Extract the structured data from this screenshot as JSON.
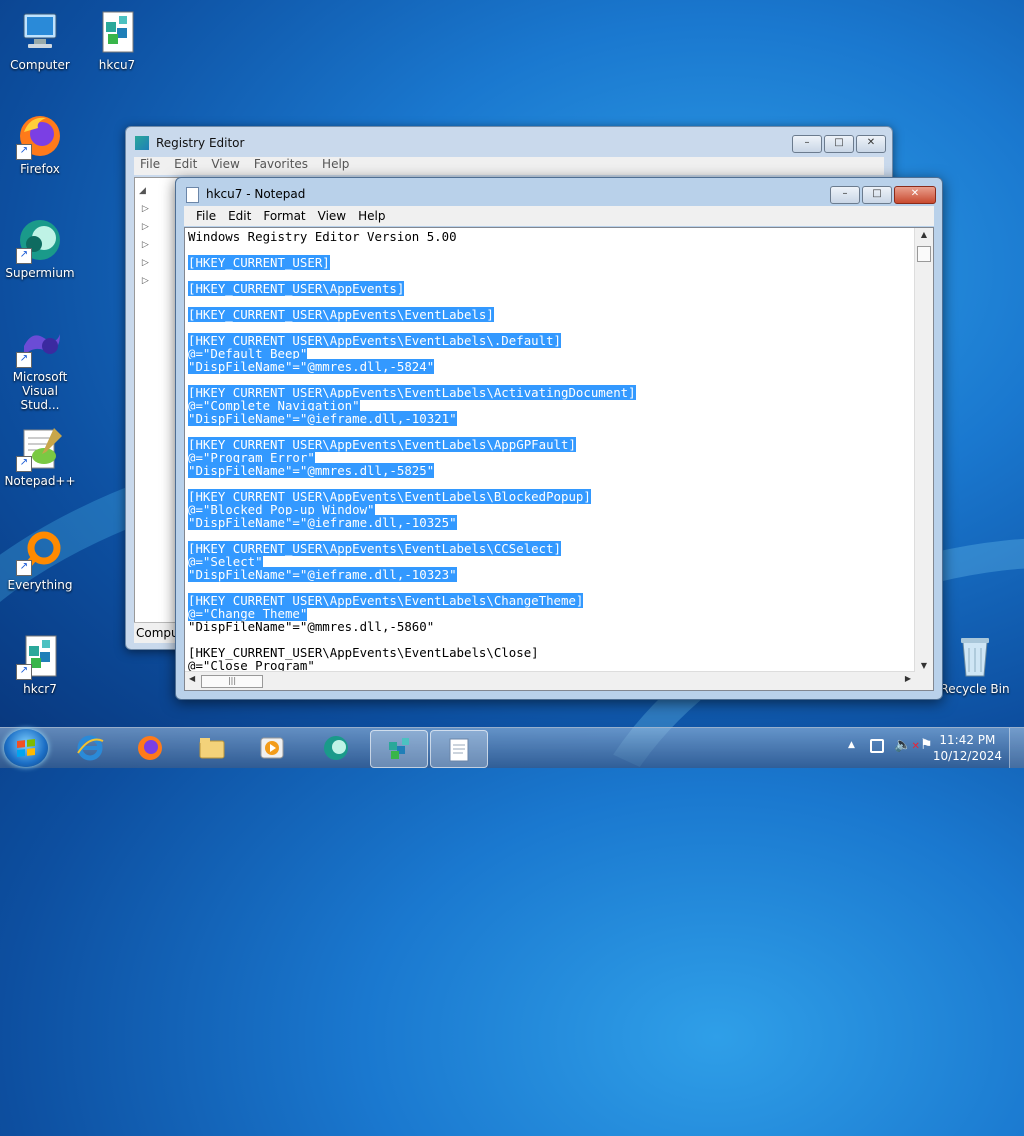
{
  "desktop": {
    "icons": [
      {
        "label": "Computer",
        "icon": "computer-icon"
      },
      {
        "label": "hkcu7",
        "icon": "registry-file-icon"
      },
      {
        "label": "Firefox",
        "icon": "firefox-icon"
      },
      {
        "label": "Supermium",
        "icon": "supermium-icon"
      },
      {
        "label": "Microsoft Visual Stud...",
        "icon": "visual-studio-icon"
      },
      {
        "label": "Notepad++",
        "icon": "notepadpp-icon"
      },
      {
        "label": "Everything",
        "icon": "everything-icon"
      },
      {
        "label": "hkcr7",
        "icon": "registry-file-icon"
      },
      {
        "label": "Recycle Bin",
        "icon": "recycle-bin-icon"
      }
    ]
  },
  "registry_editor": {
    "title": "Registry Editor",
    "menu": [
      "File",
      "Edit",
      "View",
      "Favorites",
      "Help"
    ],
    "status": "Compu"
  },
  "notepad": {
    "title": "hkcu7 - Notepad",
    "menu": [
      "File",
      "Edit",
      "Format",
      "View",
      "Help"
    ],
    "lines": [
      {
        "text": "Windows Registry Editor Version 5.00",
        "selected": false
      },
      {
        "text": "",
        "selected": false
      },
      {
        "text": "[HKEY_CURRENT_USER]",
        "selected": true
      },
      {
        "text": "",
        "selected": false
      },
      {
        "text": "[HKEY_CURRENT_USER\\AppEvents]",
        "selected": true
      },
      {
        "text": "",
        "selected": false
      },
      {
        "text": "[HKEY_CURRENT_USER\\AppEvents\\EventLabels]",
        "selected": true
      },
      {
        "text": "",
        "selected": false
      },
      {
        "text": "[HKEY_CURRENT_USER\\AppEvents\\EventLabels\\.Default]",
        "selected": true
      },
      {
        "text": "@=\"Default Beep\"",
        "selected": true
      },
      {
        "text": "\"DispFileName\"=\"@mmres.dll,-5824\"",
        "selected": true
      },
      {
        "text": "",
        "selected": false
      },
      {
        "text": "[HKEY_CURRENT_USER\\AppEvents\\EventLabels\\ActivatingDocument]",
        "selected": true
      },
      {
        "text": "@=\"Complete Navigation\"",
        "selected": true
      },
      {
        "text": "\"DispFileName\"=\"@ieframe.dll,-10321\"",
        "selected": true
      },
      {
        "text": "",
        "selected": false
      },
      {
        "text": "[HKEY_CURRENT_USER\\AppEvents\\EventLabels\\AppGPFault]",
        "selected": true
      },
      {
        "text": "@=\"Program Error\"",
        "selected": true
      },
      {
        "text": "\"DispFileName\"=\"@mmres.dll,-5825\"",
        "selected": true
      },
      {
        "text": "",
        "selected": false
      },
      {
        "text": "[HKEY_CURRENT_USER\\AppEvents\\EventLabels\\BlockedPopup]",
        "selected": true
      },
      {
        "text": "@=\"Blocked Pop-up Window\"",
        "selected": true
      },
      {
        "text": "\"DispFileName\"=\"@ieframe.dll,-10325\"",
        "selected": true
      },
      {
        "text": "",
        "selected": false
      },
      {
        "text": "[HKEY_CURRENT_USER\\AppEvents\\EventLabels\\CCSelect]",
        "selected": true
      },
      {
        "text": "@=\"Select\"",
        "selected": true
      },
      {
        "text": "\"DispFileName\"=\"@ieframe.dll,-10323\"",
        "selected": true
      },
      {
        "text": "",
        "selected": false
      },
      {
        "text": "[HKEY_CURRENT_USER\\AppEvents\\EventLabels\\ChangeTheme]",
        "selected": true
      },
      {
        "text": "@=\"Change Theme\"",
        "selected": true
      },
      {
        "text": "\"DispFileName\"=\"@mmres.dll,-5860\"",
        "selected": false
      },
      {
        "text": "",
        "selected": false
      },
      {
        "text": "[HKEY_CURRENT_USER\\AppEvents\\EventLabels\\Close]",
        "selected": false
      },
      {
        "text": "@=\"Close Program\"",
        "selected": false
      }
    ]
  },
  "window_buttons": {
    "minimize": "–",
    "maximize": "□",
    "close": "✕"
  },
  "taskbar": {
    "items": [
      {
        "icon": "internet-explorer-icon",
        "active": false
      },
      {
        "icon": "firefox-icon",
        "active": false
      },
      {
        "icon": "file-explorer-icon",
        "active": false
      },
      {
        "icon": "media-player-icon",
        "active": false
      },
      {
        "icon": "supermium-icon",
        "active": false
      },
      {
        "icon": "registry-editor-icon",
        "active": true
      },
      {
        "icon": "notepad-icon",
        "active": true
      }
    ],
    "time": "11:42 PM",
    "date": "10/12/2024"
  },
  "colors": {
    "selection": "#3399ff",
    "close_button": "#c84a2f"
  }
}
